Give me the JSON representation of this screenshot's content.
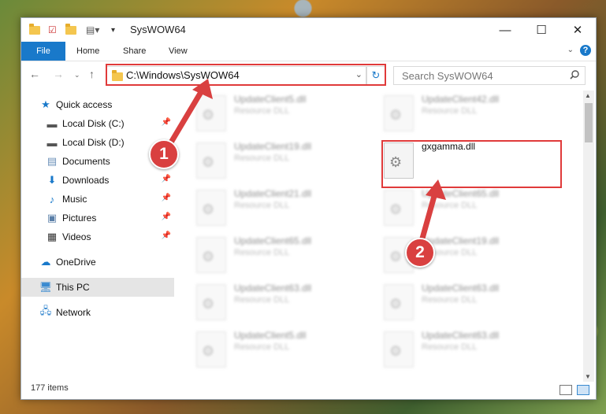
{
  "window": {
    "title": "SysWOW64"
  },
  "ribbon": {
    "file": "File",
    "home": "Home",
    "share": "Share",
    "view": "View",
    "help": "?"
  },
  "address": {
    "path": "C:\\Windows\\SysWOW64"
  },
  "search": {
    "placeholder": "Search SysWOW64"
  },
  "sidebar": {
    "items": [
      {
        "label": "Quick access",
        "icon": "star-icon"
      },
      {
        "label": "Local Disk (C:)",
        "icon": "drive-icon"
      },
      {
        "label": "Local Disk (D:)",
        "icon": "drive-icon"
      },
      {
        "label": "Documents",
        "icon": "documents-icon"
      },
      {
        "label": "Downloads",
        "icon": "downloads-icon"
      },
      {
        "label": "Music",
        "icon": "music-icon"
      },
      {
        "label": "Pictures",
        "icon": "pictures-icon"
      },
      {
        "label": "Videos",
        "icon": "videos-icon"
      },
      {
        "label": "OneDrive",
        "icon": "cloud-icon"
      },
      {
        "label": "This PC",
        "icon": "computer-icon"
      },
      {
        "label": "Network",
        "icon": "network-icon"
      }
    ]
  },
  "files": {
    "left": [
      {
        "name": "UpdateClient5.dll",
        "type": "Resource DLL"
      },
      {
        "name": "UpdateClient19.dll",
        "type": "Resource DLL"
      },
      {
        "name": "UpdateClient21.dll",
        "type": "Resource DLL"
      },
      {
        "name": "UpdateClient65.dll",
        "type": "Resource DLL"
      },
      {
        "name": "UpdateClient63.dll",
        "type": "Resource DLL"
      },
      {
        "name": "UpdateClient5.dll",
        "type": "Resource DLL"
      }
    ],
    "right": [
      {
        "name": "UpdateClient42.dll",
        "type": "Resource DLL"
      },
      {
        "name": "gxgamma.dll",
        "type": ""
      },
      {
        "name": "UpdateClient65.dll",
        "type": "Resource DLL"
      },
      {
        "name": "UpdateClient19.dll",
        "type": "Resource DLL"
      },
      {
        "name": "UpdateClient63.dll",
        "type": "Resource DLL"
      },
      {
        "name": "UpdateClient63.dll",
        "type": "Resource DLL"
      }
    ]
  },
  "status": {
    "items": "177 items"
  },
  "annotations": {
    "step1": "1",
    "step2": "2"
  },
  "colors": {
    "accent": "#1979ca",
    "highlight": "#e03a3a"
  }
}
